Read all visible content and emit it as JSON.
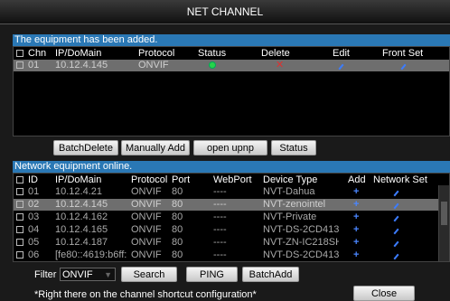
{
  "title": "NET CHANNEL",
  "added": {
    "heading": "The equipment has been added.",
    "columns": {
      "chn": "Chn",
      "ip": "IP/DoMain",
      "protocol": "Protocol",
      "status": "Status",
      "delete": "Delete",
      "edit": "Edit",
      "front": "Front Set"
    },
    "rows": [
      {
        "chn": "01",
        "ip": "10.12.4.145",
        "protocol": "ONVIF",
        "status": "online",
        "delete_icon": "red-x",
        "edit_icon": "pencil",
        "front_icon": "pencil"
      }
    ]
  },
  "buttons": {
    "batch_delete": "BatchDelete",
    "manual_add": "Manually Add",
    "open_upnp": "open upnp",
    "status": "Status",
    "search": "Search",
    "ping": "PING",
    "batch_add": "BatchAdd",
    "close": "Close"
  },
  "online": {
    "heading": "Network equipment online.",
    "columns": {
      "id": "ID",
      "ip": "IP/DoMain",
      "protocol": "Protocol",
      "port": "Port",
      "webport": "WebPort",
      "type": "Device Type",
      "add": "Add",
      "network": "Network Set"
    },
    "rows": [
      {
        "id": "01",
        "ip": "10.12.4.21",
        "protocol": "ONVIF",
        "port": "80",
        "webport": "----",
        "type": "NVT-Dahua"
      },
      {
        "id": "02",
        "ip": "10.12.4.145",
        "protocol": "ONVIF",
        "port": "80",
        "webport": "----",
        "type": "NVT-zenointel"
      },
      {
        "id": "03",
        "ip": "10.12.4.162",
        "protocol": "ONVIF",
        "port": "80",
        "webport": "----",
        "type": "NVT-Private"
      },
      {
        "id": "04",
        "ip": "10.12.4.165",
        "protocol": "ONVIF",
        "port": "80",
        "webport": "----",
        "type": "NVT-DS-2CD413:"
      },
      {
        "id": "05",
        "ip": "10.12.4.187",
        "protocol": "ONVIF",
        "port": "80",
        "webport": "----",
        "type": "NVT-ZN-IC218SH"
      },
      {
        "id": "06",
        "ip": "[fe80::4619:b6ff:",
        "protocol": "ONVIF",
        "port": "80",
        "webport": "----",
        "type": "NVT-DS-2CD413:"
      }
    ]
  },
  "filter": {
    "label": "Filter",
    "value": "ONVIF"
  },
  "hint": "*Right there on the channel shortcut configuration*",
  "colors": {
    "accent": "#2a78b5",
    "selected_row": "#6e6e6e",
    "status_online": "#27d34a",
    "delete": "#e03030",
    "edit": "#3c7cff"
  }
}
